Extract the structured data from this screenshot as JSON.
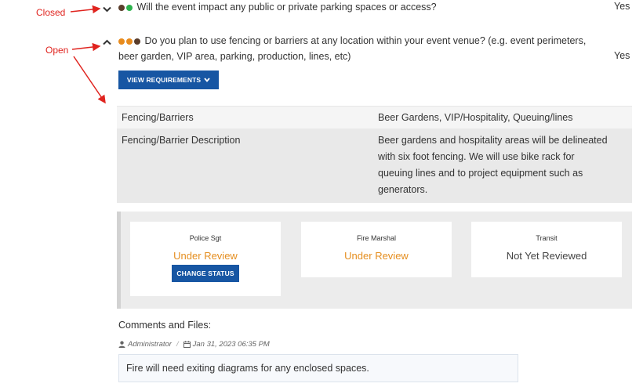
{
  "annotations": {
    "closed_label": "Closed",
    "open_label": "Open"
  },
  "colors": {
    "annotation": "#e0241f",
    "primary_button": "#1756a3",
    "under_review": "#e58e1f",
    "dot_brown": "#5a3d2b",
    "dot_green": "#2bb24c",
    "dot_orange": "#e88b1d"
  },
  "questions": [
    {
      "state": "closed",
      "chevron_icon": "chevron-down-icon",
      "text": "Will the event impact any public or private parking spaces or access?",
      "answer": "Yes"
    },
    {
      "state": "open",
      "chevron_icon": "chevron-up-icon",
      "text_line1": "Do you plan to use fencing or barriers at any location within your event venue? (e.g. event perimeters,",
      "text_line2": "beer garden, VIP area, parking, production, lines, etc)",
      "answer": "Yes",
      "button_label": "VIEW REQUIREMENTS"
    }
  ],
  "details": [
    {
      "label": "Fencing/Barriers",
      "value": "Beer Gardens, VIP/Hospitality, Queuing/lines"
    },
    {
      "label": "Fencing/Barrier Description",
      "value_lines": [
        "Beer gardens and hospitality areas will be delineated",
        "with six foot fencing. We will use bike rack for",
        "queuing lines and to project equipment such as",
        "generators."
      ]
    }
  ],
  "reviews": [
    {
      "role": "Police Sgt",
      "status": "Under Review",
      "button_label": "CHANGE STATUS"
    },
    {
      "role": "Fire Marshal",
      "status": "Under Review"
    },
    {
      "role": "Transit",
      "status": "Not Yet Reviewed"
    }
  ],
  "comments": {
    "heading": "Comments and Files:",
    "author": "Administrator",
    "separator": "/",
    "date": "Jan 31, 2023 06:35 PM",
    "text": "Fire will need exiting diagrams for any enclosed spaces."
  }
}
